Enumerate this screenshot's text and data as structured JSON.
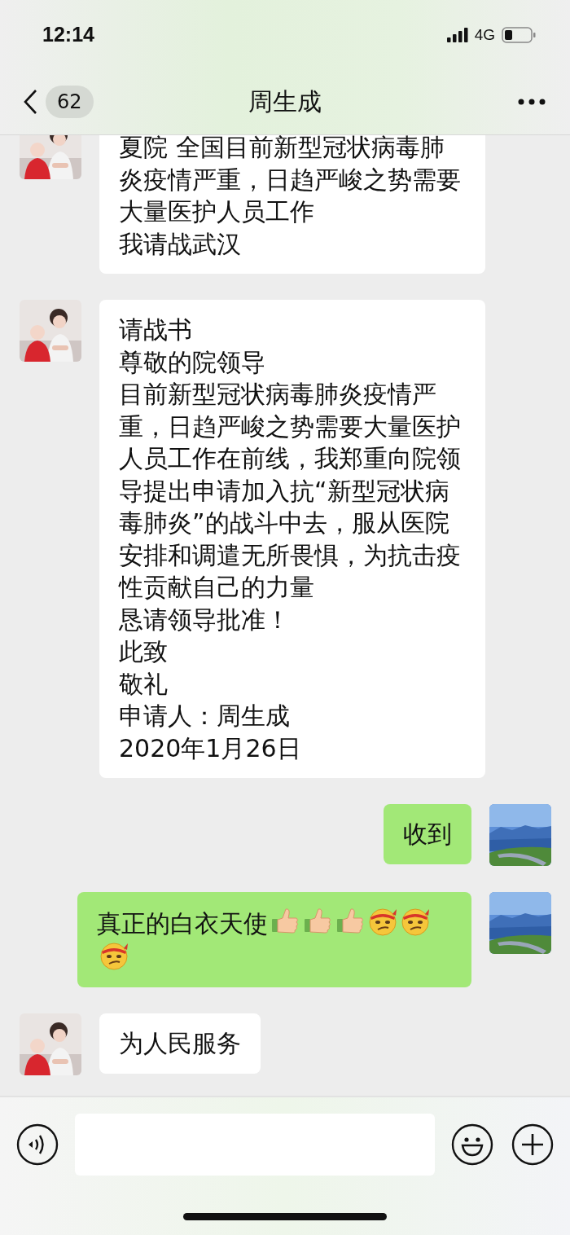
{
  "status_bar": {
    "time": "12:14",
    "network": "4G"
  },
  "nav": {
    "unread_count": "62",
    "title": "周生成"
  },
  "messages": [
    {
      "kind": "incoming",
      "paragraphs": [
        "夏院  全国目前新型冠状病毒肺炎疫情严重，日趋严峻之势需要大量医护人员工作",
        "我请战武汉"
      ]
    },
    {
      "kind": "incoming",
      "paragraphs": [
        "请战书",
        "尊敬的院领导",
        "目前新型冠状病毒肺炎疫情严重，日趋严峻之势需要大量医护人员工作在前线，我郑重向院领导提出申请加入抗“新型冠状病毒肺炎”的战斗中去，服从医院安排和调遣无所畏惧，为抗击疫性贡献自己的力量",
        "恳请领导批准！",
        "此致",
        "敬礼",
        "申请人：周生成",
        "2020年1月26日"
      ]
    },
    {
      "kind": "outgoing",
      "paragraphs": [
        "收到"
      ]
    },
    {
      "kind": "outgoing",
      "paragraphs": [
        "真正的白衣天使"
      ],
      "emoji": [
        {
          "kind": "thumbs_up"
        },
        {
          "kind": "thumbs_up"
        },
        {
          "kind": "thumbs_up"
        },
        {
          "kind": "grumpy"
        },
        {
          "kind": "grumpy"
        },
        {
          "kind": "grumpy"
        }
      ]
    },
    {
      "kind": "incoming",
      "paragraphs": [
        "为人民服务"
      ]
    }
  ]
}
